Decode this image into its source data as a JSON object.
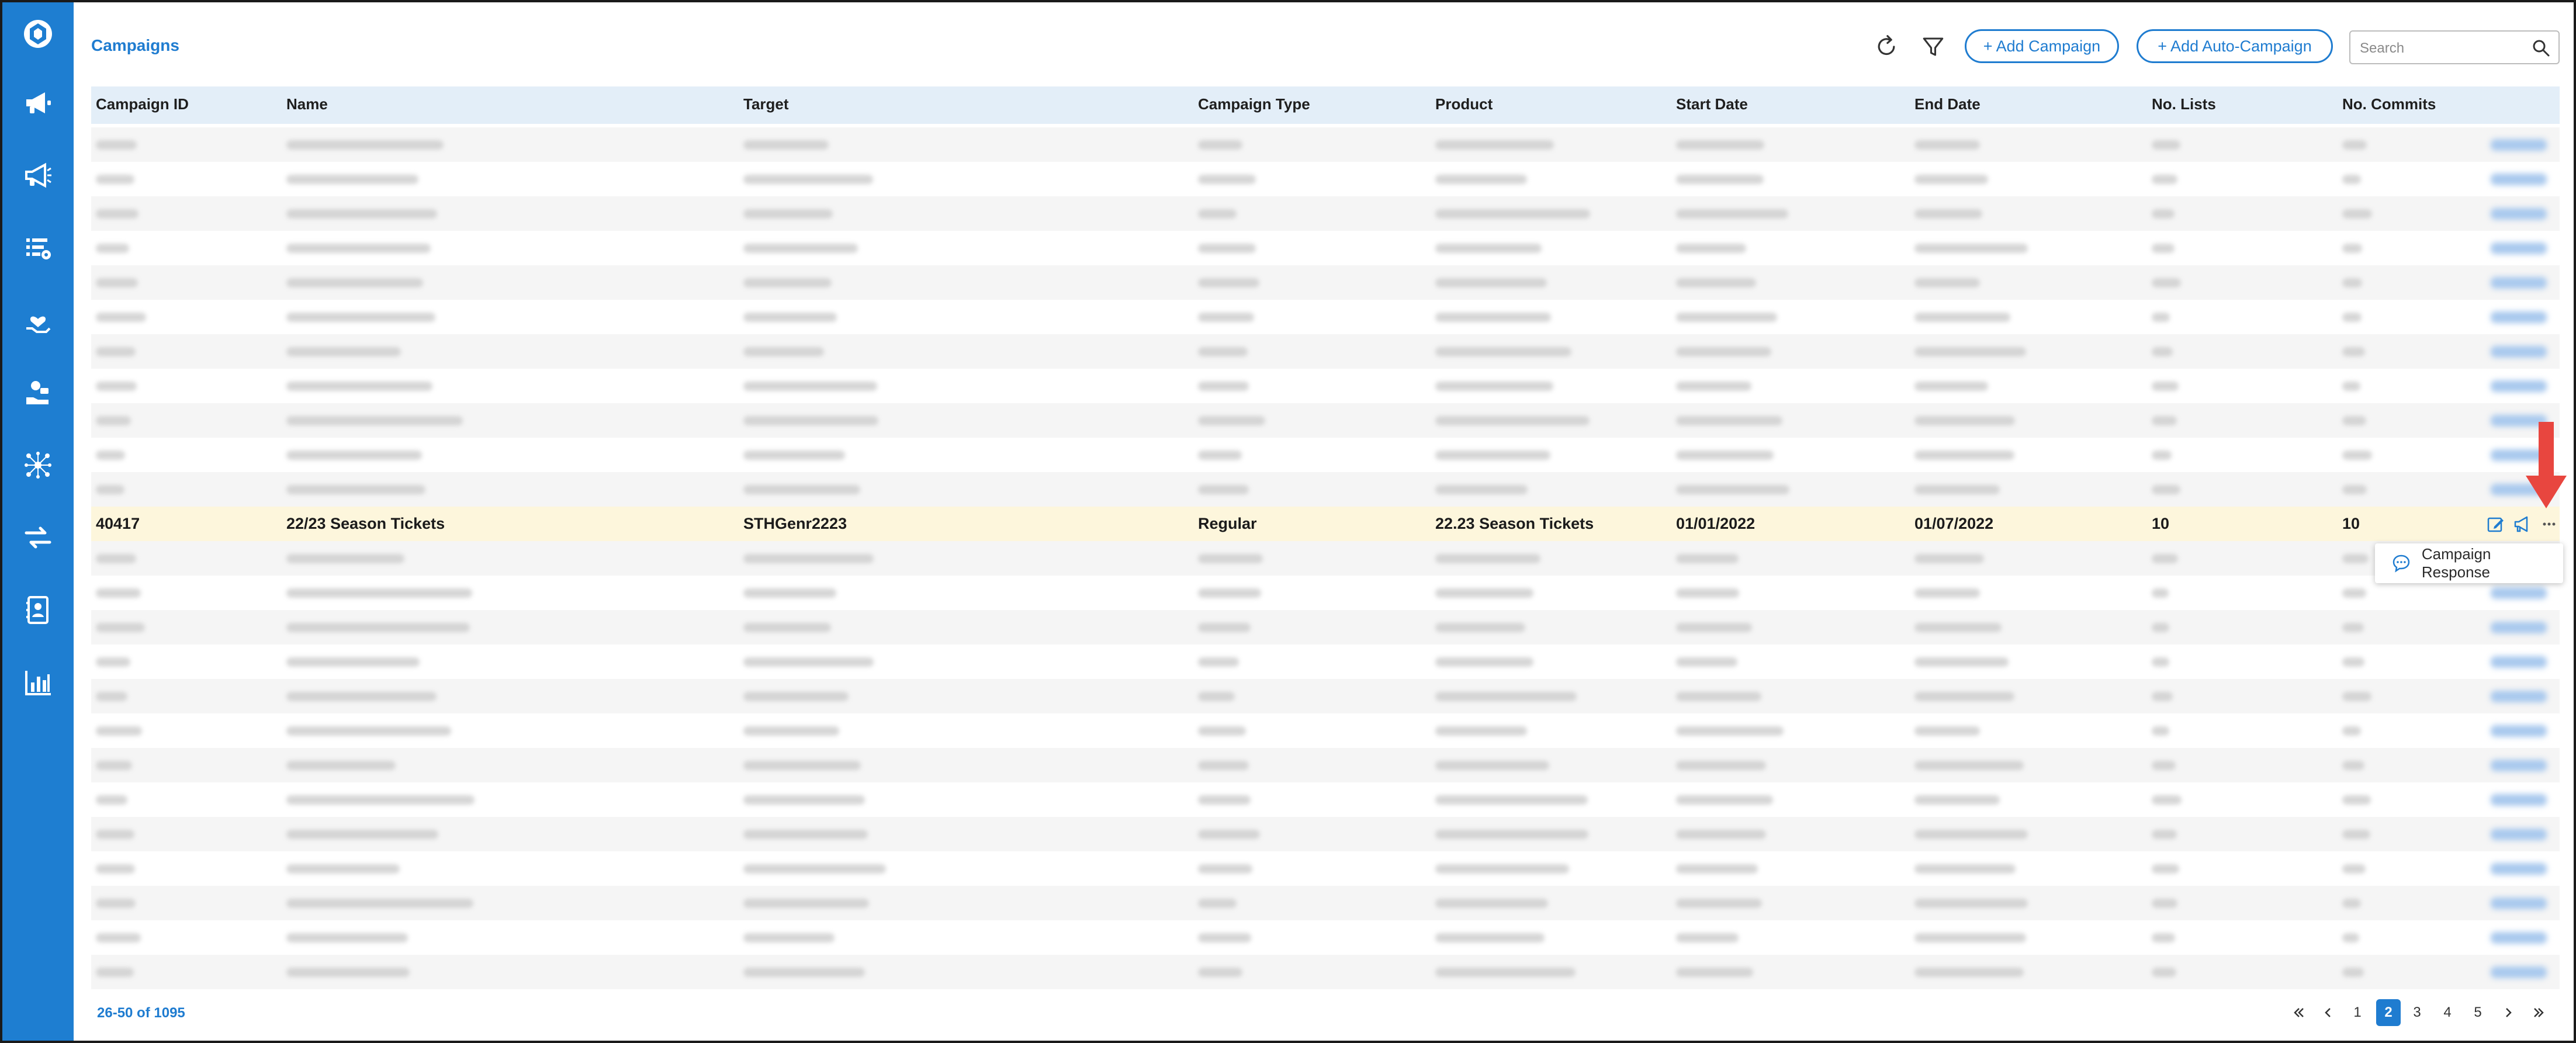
{
  "header": {
    "title": "Campaigns",
    "add_campaign_label": "+ Add Campaign",
    "add_auto_campaign_label": "+ Add Auto-Campaign",
    "search_placeholder": "Search"
  },
  "sidebar": {
    "icons": [
      "logo-icon",
      "megaphone-icon",
      "megaphone-outline-icon",
      "list-settings-icon",
      "hand-heart-icon",
      "hand-coin-icon",
      "network-icon",
      "transfer-icon",
      "contact-book-icon",
      "bar-chart-icon"
    ]
  },
  "table": {
    "columns": [
      "Campaign ID",
      "Name",
      "Target",
      "Campaign Type",
      "Product",
      "Start Date",
      "End Date",
      "No. Lists",
      "No. Commits"
    ],
    "highlight_row": {
      "campaign_id": "40417",
      "name": "22/23 Season Tickets",
      "target": "STHGenr2223",
      "campaign_type": "Regular",
      "product": "22.23 Season Tickets",
      "start_date": "01/01/2022",
      "end_date": "01/07/2022",
      "no_lists": "10",
      "no_commits": "10"
    },
    "blurred_rows_before": 11,
    "blurred_rows_after": 13
  },
  "popup": {
    "label": "Campaign Response"
  },
  "footer": {
    "count_text": "26-50 of 1095",
    "pages": [
      "1",
      "2",
      "3",
      "4",
      "5"
    ],
    "current_page": "2"
  },
  "colors": {
    "accent": "#1f7cd0",
    "sidebar": "#1e7ed1",
    "highlight_row": "#fdf6dc",
    "arrow": "#e8463f"
  }
}
